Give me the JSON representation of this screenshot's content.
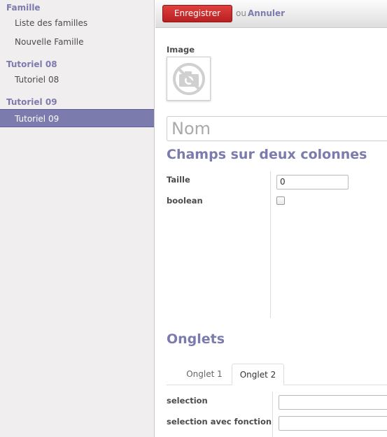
{
  "sidebar": {
    "sections": [
      {
        "title": "Famille",
        "items": [
          "Liste des familles",
          "Nouvelle Famille"
        ]
      },
      {
        "title": "Tutoriel 08",
        "items": [
          "Tutoriel 08"
        ]
      },
      {
        "title": "Tutoriel 09",
        "items": [
          "Tutoriel 09"
        ]
      }
    ],
    "active_item": "Tutoriel 09"
  },
  "toolbar": {
    "save_label": "Enregistrer",
    "or_text": "ou",
    "cancel_label": "Annuler"
  },
  "form": {
    "image_label": "Image",
    "image_icon": "no-photo-camera-icon",
    "name_placeholder": "Nom",
    "section_two_columns": "Champs sur deux colonnes",
    "taille_label": "Taille",
    "taille_value": "0",
    "boolean_label": "boolean",
    "boolean_checked": false,
    "tabs_title": "Onglets",
    "tabs": [
      "Onglet 1",
      "Onglet 2"
    ],
    "active_tab": "Onglet 2",
    "selection_label": "selection",
    "selection_fn_label": "selection avec fonction"
  },
  "colors": {
    "accent": "#7c7bad",
    "save_button": "#cc2e2e"
  }
}
